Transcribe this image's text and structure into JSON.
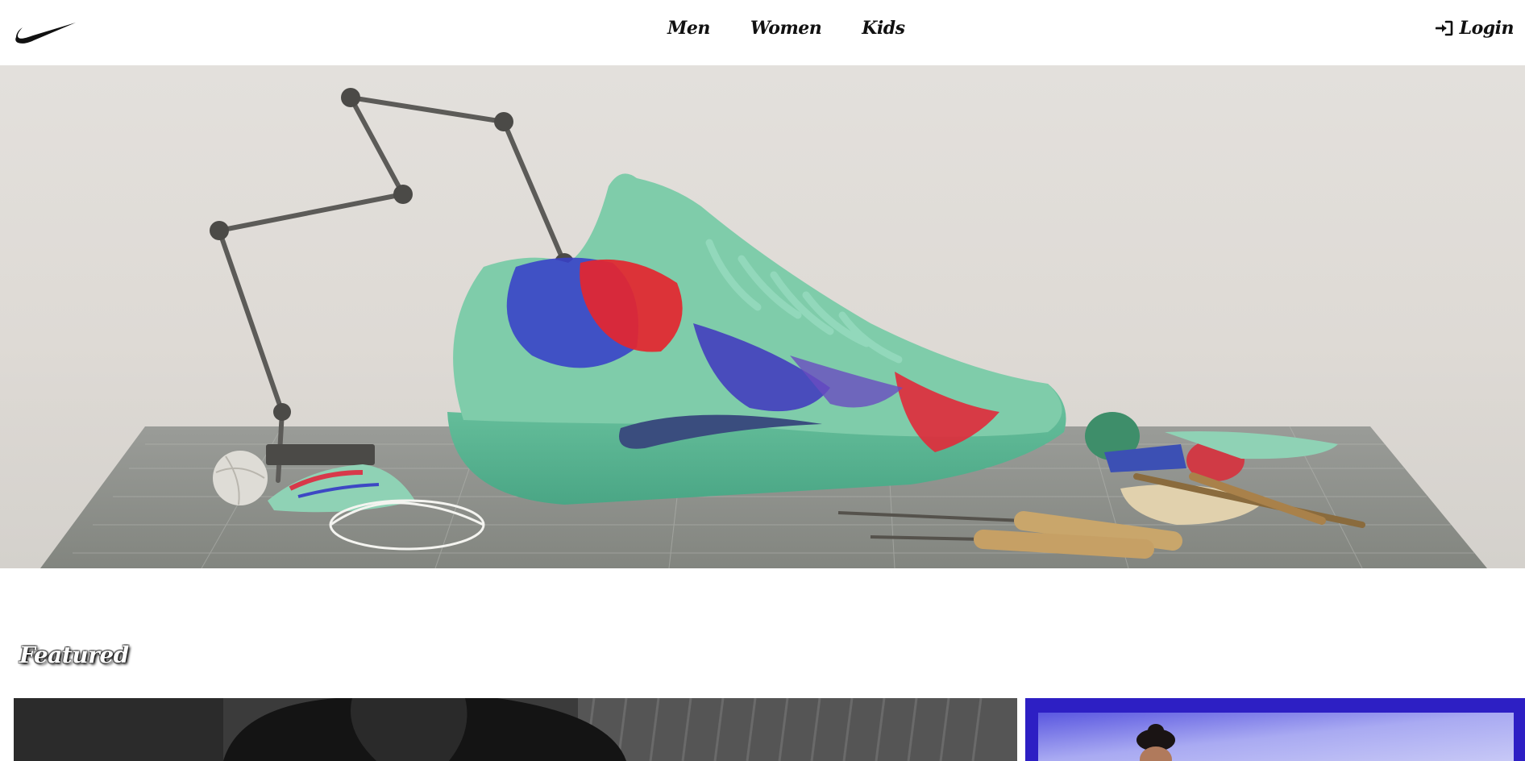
{
  "header": {
    "logo_icon": "swoosh-logo-icon",
    "nav": [
      {
        "label": "Men"
      },
      {
        "label": "Women"
      },
      {
        "label": "Kids"
      }
    ],
    "login": {
      "label": "Login",
      "icon": "sign-in-icon"
    }
  },
  "hero": {
    "image": "basketball-shoe-on-cutting-mat-hero-image",
    "colors": {
      "background": "#e0ddd9",
      "shoe": "#7dcaa6",
      "mat": "#8e918d"
    }
  },
  "featured": {
    "title": "Featured",
    "cards": [
      {
        "image": "black-and-white-athlete-photo"
      },
      {
        "image": "person-on-purple-blue-background-photo"
      }
    ]
  }
}
